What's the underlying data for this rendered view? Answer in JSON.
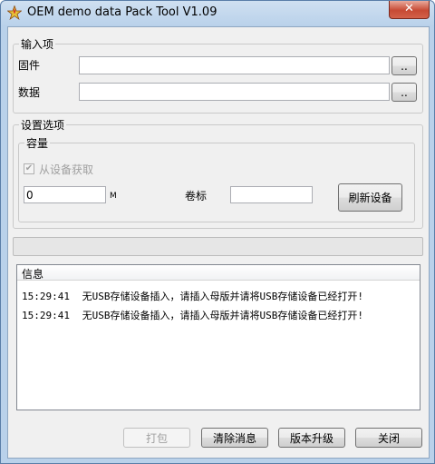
{
  "window": {
    "title": "OEM demo data Pack Tool V1.09",
    "close_symbol": "✕"
  },
  "input_group": {
    "title": "输入项",
    "firmware_label": "固件",
    "firmware_value": "",
    "firmware_browse": "..",
    "data_label": "数据",
    "data_value": "",
    "data_browse": ".."
  },
  "settings_group": {
    "title": "设置选项",
    "capacity_group": {
      "title": "容量",
      "from_device_label": "从设备获取",
      "from_device_checked": true,
      "capacity_value": "0",
      "unit": "M",
      "volume_label": "卷标",
      "volume_value": "",
      "refresh_button": "刷新设备"
    }
  },
  "progress": {
    "value": 0
  },
  "info": {
    "header": "信息",
    "messages": [
      {
        "time": "15:29:41",
        "text": "无USB存储设备插入，请插入母版并请将USB存储设备已经打开!"
      },
      {
        "time": "15:29:41",
        "text": "无USB存储设备插入，请插入母版并请将USB存储设备已经打开!"
      }
    ]
  },
  "buttons": {
    "pack": "打包",
    "clear": "清除消息",
    "upgrade": "版本升级",
    "close": "关闭"
  }
}
